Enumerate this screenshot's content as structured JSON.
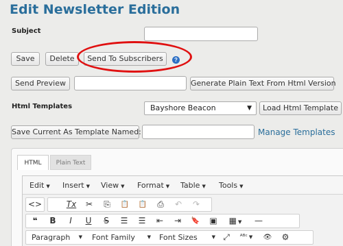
{
  "page": {
    "title": "Edit Newsletter Edition"
  },
  "subject": {
    "label": "Subject",
    "value": ""
  },
  "actions": {
    "save": "Save",
    "delete": "Delete",
    "send_to_subscribers": "Send To Subscribers",
    "help": "?"
  },
  "preview": {
    "send_preview": "Send Preview",
    "email_value": "",
    "generate_plain_text": "Generate Plain Text From Html Version"
  },
  "templates": {
    "label": "Html Templates",
    "selected": "Bayshore Beacon",
    "load_button": "Load Html Template",
    "save_current_button": "Save Current As Template Named:",
    "template_name_value": "",
    "manage_link": "Manage Templates"
  },
  "editor": {
    "tabs": [
      {
        "label": "HTML",
        "active": true
      },
      {
        "label": "Plain Text",
        "active": false
      }
    ],
    "menus": [
      "Edit",
      "Insert",
      "View",
      "Format",
      "Table",
      "Tools"
    ],
    "toolbar_row1": [
      {
        "name": "source-code-icon",
        "glyph": "<>"
      },
      {
        "name": "clear-formatting-icon",
        "glyph": "Tx"
      },
      {
        "name": "cut-icon",
        "glyph": "✂"
      },
      {
        "name": "copy-icon",
        "glyph": "⎘"
      },
      {
        "name": "paste-icon",
        "glyph": "📋"
      },
      {
        "name": "paste-text-icon",
        "glyph": "📋"
      },
      {
        "name": "print-icon",
        "glyph": "⎙"
      },
      {
        "name": "undo-icon",
        "glyph": "↶"
      },
      {
        "name": "redo-icon",
        "glyph": "↷"
      }
    ],
    "toolbar_row2": [
      {
        "name": "blockquote-icon",
        "glyph": "❝"
      },
      {
        "name": "bold-icon",
        "glyph": "B"
      },
      {
        "name": "italic-icon",
        "glyph": "I"
      },
      {
        "name": "underline-icon",
        "glyph": "U"
      },
      {
        "name": "strikethrough-icon",
        "glyph": "S"
      },
      {
        "name": "bullet-list-icon",
        "glyph": "☰"
      },
      {
        "name": "numbered-list-icon",
        "glyph": "☰"
      },
      {
        "name": "outdent-icon",
        "glyph": "⇤"
      },
      {
        "name": "indent-icon",
        "glyph": "⇥"
      },
      {
        "name": "bookmark-icon",
        "glyph": "🔖"
      },
      {
        "name": "image-icon",
        "glyph": "▣"
      },
      {
        "name": "table-icon",
        "glyph": "▦"
      },
      {
        "name": "horizontal-rule-icon",
        "glyph": "—"
      }
    ],
    "format_dropdowns": {
      "block": "Paragraph",
      "font_family": "Font Family",
      "font_size": "Font Sizes"
    },
    "toolbar_row3_icons": [
      {
        "name": "fullscreen-icon",
        "glyph": "⤢"
      },
      {
        "name": "spellcheck-icon",
        "glyph": "ᴬᴮᶜ"
      },
      {
        "name": "preview-icon",
        "glyph": "👁"
      },
      {
        "name": "settings-icon",
        "glyph": "⚙"
      }
    ]
  },
  "colors": {
    "title": "#2a6e9b",
    "annotation_circle": "#e01010",
    "help_icon": "#2d6fc4"
  }
}
